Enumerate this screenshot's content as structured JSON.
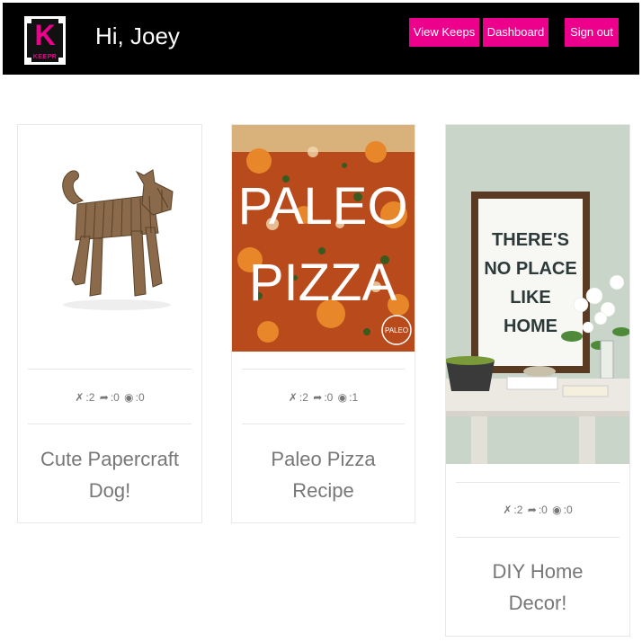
{
  "header": {
    "logo_letter": "K",
    "logo_text": "KEEPR",
    "greeting": "Hi, Joey",
    "buttons": {
      "view_keeps": "View Keeps",
      "dashboard": "Dashboard",
      "sign_out": "Sign out"
    }
  },
  "colors": {
    "accent": "#ec008c",
    "navbar": "#000000",
    "text_muted": "#777777"
  },
  "keeps": [
    {
      "title": "Cute Papercraft Dog!",
      "keeps_label": ":2",
      "shares_label": ":0",
      "views_label": ":0",
      "image": "papercraft-dog"
    },
    {
      "title": "Paleo Pizza Recipe",
      "keeps_label": ":2",
      "shares_label": ":0",
      "views_label": ":1",
      "image": "paleo-pizza",
      "image_text_1": "PALEO",
      "image_text_2": "PIZZA",
      "image_badge": "PALEO"
    },
    {
      "title": "DIY Home Decor!",
      "keeps_label": ":2",
      "shares_label": ":0",
      "views_label": ":0",
      "image": "home-decor",
      "image_text": [
        "THERE'S",
        "NO PLACE",
        "LIKE",
        "HOME"
      ]
    }
  ]
}
